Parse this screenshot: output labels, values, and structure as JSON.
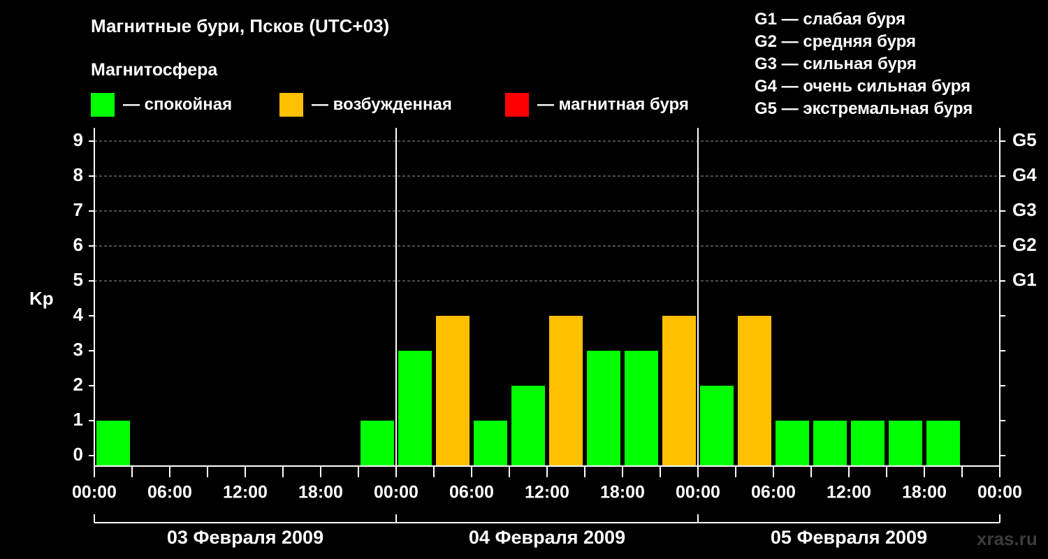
{
  "title": "Магнитные бури, Псков (UTC+03)",
  "subtitle": "Магнитосфера",
  "legend": [
    {
      "color": "#00ff00",
      "label": "— спокойная"
    },
    {
      "color": "#ffc000",
      "label": "— возбужденная"
    },
    {
      "color": "#ff0000",
      "label": "— магнитная буря"
    }
  ],
  "g_scale": [
    "G1 — слабая буря",
    "G2 — средняя буря",
    "G3 — сильная буря",
    "G4 — очень сильная буря",
    "G5 — экстремальная буря"
  ],
  "watermark": "xras.ru",
  "chart_data": {
    "type": "bar",
    "ylabel": "Kp",
    "ylim": [
      0,
      9
    ],
    "y_ticks": [
      0,
      1,
      2,
      3,
      4,
      5,
      6,
      7,
      8,
      9
    ],
    "right_axis_labels": [
      {
        "kp": 5,
        "label": "G1"
      },
      {
        "kp": 6,
        "label": "G2"
      },
      {
        "kp": 7,
        "label": "G3"
      },
      {
        "kp": 8,
        "label": "G4"
      },
      {
        "kp": 9,
        "label": "G5"
      }
    ],
    "x_tick_labels": [
      "00:00",
      "06:00",
      "12:00",
      "18:00",
      "00:00",
      "06:00",
      "12:00",
      "18:00",
      "00:00",
      "06:00",
      "12:00",
      "18:00",
      "00:00"
    ],
    "days": [
      "03 Февраля 2009",
      "04 Февраля 2009",
      "05 Февраля 2009"
    ],
    "interval_hours": 3,
    "values": [
      1,
      0,
      0,
      0,
      0,
      0,
      0,
      1,
      3,
      4,
      1,
      2,
      4,
      3,
      3,
      4,
      2,
      4,
      1,
      1,
      1,
      1,
      1,
      0
    ],
    "colors": [
      "#00ff00",
      "#00ff00",
      "#00ff00",
      "#00ff00",
      "#00ff00",
      "#00ff00",
      "#00ff00",
      "#00ff00",
      "#00ff00",
      "#ffc000",
      "#00ff00",
      "#00ff00",
      "#ffc000",
      "#00ff00",
      "#00ff00",
      "#ffc000",
      "#00ff00",
      "#ffc000",
      "#00ff00",
      "#00ff00",
      "#00ff00",
      "#00ff00",
      "#00ff00",
      "#00ff00"
    ],
    "grid": "dashed horizontal at Kp 5–9"
  }
}
